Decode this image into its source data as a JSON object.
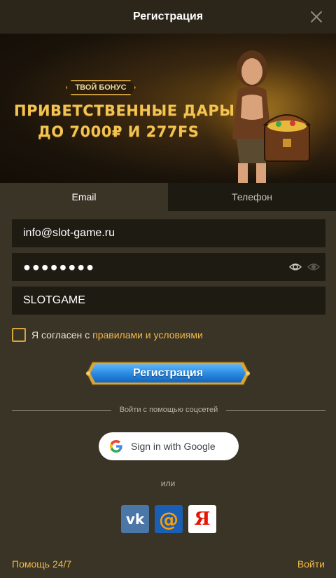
{
  "header": {
    "title": "Регистрация"
  },
  "banner": {
    "tag": "ТВОЙ БОНУС",
    "line1": "ПРИВЕТСТВЕННЫЕ ДАРЫ",
    "line2": "ДО 7000₽ И 277FS"
  },
  "tabs": [
    {
      "label": "Email",
      "active": true
    },
    {
      "label": "Телефон",
      "active": false
    }
  ],
  "form": {
    "email_value": "info@slot-game.ru",
    "password_value": "●●●●●●●●",
    "promo_value": "SLOTGAME",
    "agree_text": "Я согласен с",
    "agree_link": "правилами и условиями",
    "submit_label": "Регистрация"
  },
  "social": {
    "divider_text": "Войти с помощью соцсетей",
    "google_label": "Sign in with Google",
    "or_text": "или",
    "vk_label": "vk",
    "mail_label": "@",
    "yandex_label": "Я"
  },
  "footer": {
    "help_label": "Помощь 24/7",
    "login_label": "Войти"
  },
  "colors": {
    "accent": "#f0b94a",
    "background": "#3a3426",
    "field_bg": "#1e1b13",
    "button_blue": "#2a8be0"
  }
}
